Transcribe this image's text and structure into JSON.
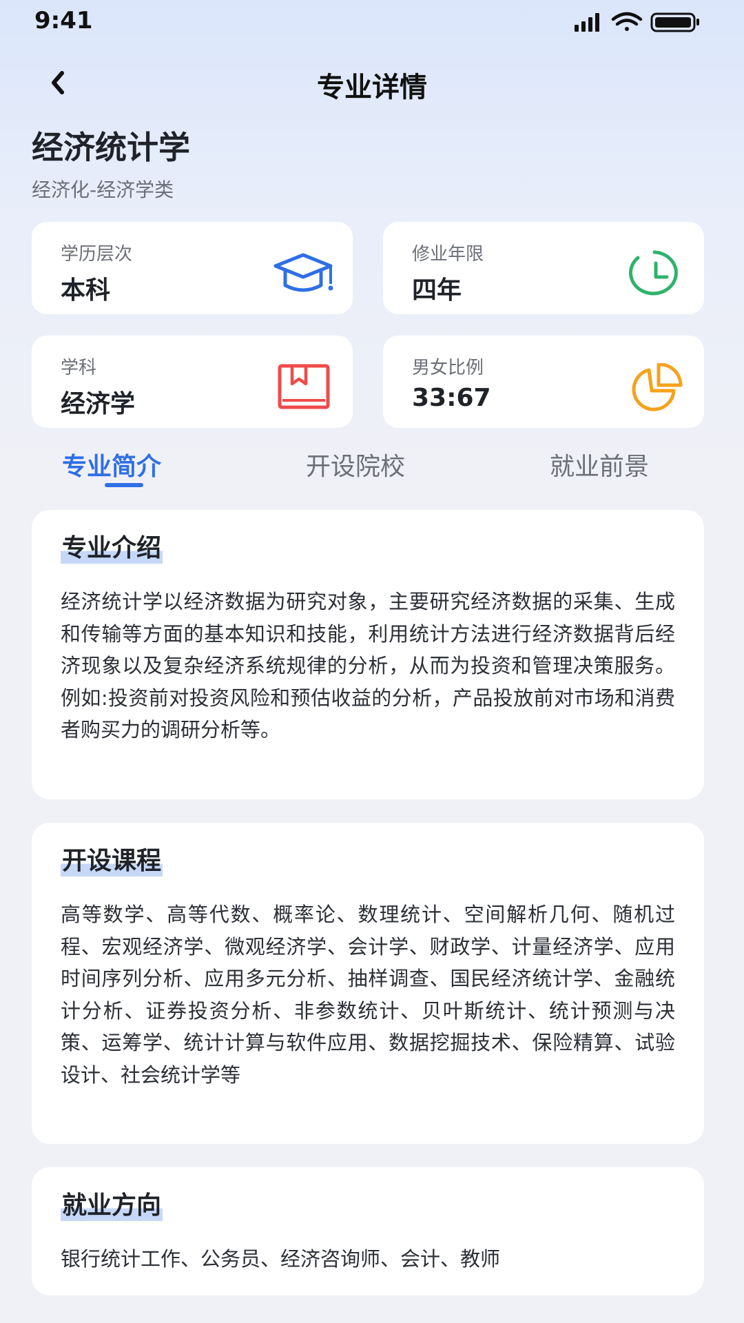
{
  "status_bar": {
    "time": "9:41"
  },
  "nav": {
    "title": "专业详情"
  },
  "major": {
    "name": "经济统计学",
    "category": "经济化-经济学类"
  },
  "info_cards": [
    {
      "label": "学历层次",
      "value": "本科",
      "icon": "graduation-cap-icon",
      "color": "#2f6fe6"
    },
    {
      "label": "修业年限",
      "value": "四年",
      "icon": "clock-icon",
      "color": "#2fb36b"
    },
    {
      "label": "学科",
      "value": "经济学",
      "icon": "book-icon",
      "color": "#ef4b4b"
    },
    {
      "label": "男女比例",
      "value": "33:67",
      "icon": "pie-chart-icon",
      "color": "#f5a21b"
    }
  ],
  "tabs": [
    {
      "label": "专业简介",
      "active": true
    },
    {
      "label": "开设院校",
      "active": false
    },
    {
      "label": "就业前景",
      "active": false
    }
  ],
  "sections": {
    "intro": {
      "title": "专业介绍",
      "text": "经济统计学以经济数据为研究对象，主要研究经济数据的采集、生成和传输等方面的基本知识和技能，利用统计方法进行经济数据背后经济现象以及复杂经济系统规律的分析，从而为投资和管理决策服务。例如:投资前对投资风险和预估收益的分析，产品投放前对市场和消费者购买力的调研分析等。"
    },
    "courses": {
      "title": "开设课程",
      "text": "高等数学、高等代数、概率论、数理统计、空间解析几何、随机过程、宏观经济学、微观经济学、会计学、财政学、计量经济学、应用时间序列分析、应用多元分析、抽样调查、国民经济统计学、金融统计分析、证券投资分析、非参数统计、贝叶斯统计、统计预测与决策、运筹学、统计计算与软件应用、数据挖掘技术、保险精算、试验设计、社会统计学等"
    },
    "careers": {
      "title": "就业方向",
      "text": "银行统计工作、公务员、经济咨询师、会计、教师"
    }
  },
  "colors": {
    "accent": "#2f6fe6",
    "highlight": "#c5d8f8"
  }
}
